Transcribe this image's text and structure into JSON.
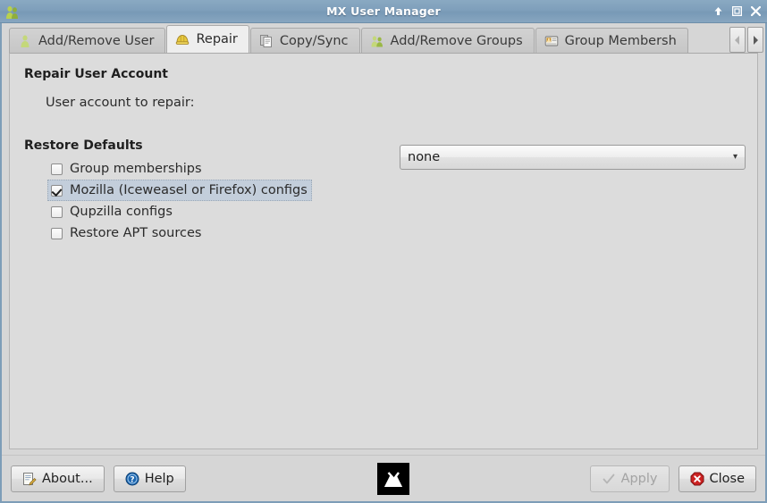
{
  "window": {
    "title": "MX User Manager",
    "icon": "users-group-icon",
    "controls": [
      {
        "name": "shade-button",
        "glyph": "arrow-up-icon"
      },
      {
        "name": "maximize-button",
        "glyph": "square-icon"
      },
      {
        "name": "close-button",
        "glyph": "x-icon"
      }
    ]
  },
  "tabs": [
    {
      "label": "Add/Remove User",
      "icon": "user-icon",
      "active": false
    },
    {
      "label": "Repair",
      "icon": "hardhat-icon",
      "active": true
    },
    {
      "label": "Copy/Sync",
      "icon": "copy-documents-icon",
      "active": false
    },
    {
      "label": "Add/Remove Groups",
      "icon": "users-group-icon",
      "active": false
    },
    {
      "label": "Group Membersh",
      "icon": "id-card-icon",
      "active": false
    }
  ],
  "tab_scroll": {
    "left_label": "◂",
    "right_label": "▸"
  },
  "main": {
    "repair_section_title": "Repair User Account",
    "user_account_label": "User account to repair:",
    "user_account_value": "none",
    "combo_arrow": "▾",
    "restore_section_title": "Restore Defaults",
    "checkboxes": [
      {
        "label": "Group memberships",
        "checked": false,
        "focused": false
      },
      {
        "label": "Mozilla (Iceweasel or Firefox) configs",
        "checked": true,
        "focused": true
      },
      {
        "label": "Qupzilla configs",
        "checked": false,
        "focused": false
      },
      {
        "label": "Restore APT sources",
        "checked": false,
        "focused": false
      }
    ]
  },
  "footer": {
    "about_label": "About...",
    "help_label": "Help",
    "apply_label": "Apply",
    "apply_disabled": true,
    "close_label": "Close",
    "logo_name": "mx-linux-logo"
  },
  "colors": {
    "titlebar": "#7e9fbb",
    "window_bg": "#d6d6d6",
    "panel_bg": "#dcdcdc",
    "focus_highlight": "#c3cedb",
    "accent_green": "#a5c14a",
    "accent_yellow": "#e0c236",
    "accent_red": "#cc2222",
    "accent_blue": "#1c66b0"
  }
}
